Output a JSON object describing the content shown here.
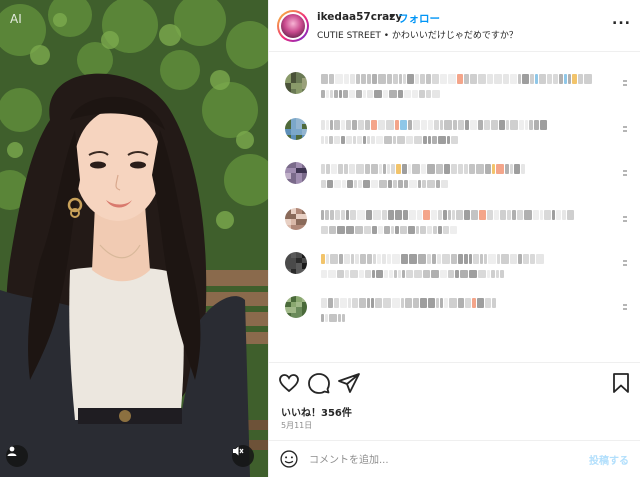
{
  "colors": {
    "accent": "#0095f6",
    "post_disabled": "#b2dffc",
    "text_primary": "#262626",
    "text_secondary": "#8e8e8e",
    "divider": "#efefef"
  },
  "media": {
    "ai_label": "AI",
    "icons": [
      "user-tag-icon",
      "mute-icon"
    ]
  },
  "header": {
    "username": "ikedaa57crazy",
    "separator": "•",
    "follow_label": "フォロー",
    "subtitle": "CUTIE STREET • かわいいだけじゃだめですか？",
    "more_icon": "more-options-icon",
    "more_label": "..."
  },
  "comments": [
    {
      "status": "pixelated"
    },
    {
      "status": "pixelated"
    },
    {
      "status": "pixelated"
    },
    {
      "status": "pixelated"
    },
    {
      "status": "pixelated"
    },
    {
      "status": "pixelated"
    }
  ],
  "actions": {
    "icons": [
      "heart-icon",
      "comment-icon",
      "share-icon",
      "bookmark-icon"
    ]
  },
  "likes_text": "いいね！356件",
  "date_text": "5月11日",
  "composer": {
    "emoji_icon": "emoji-icon",
    "placeholder": "コメントを追加...",
    "post_label": "投稿する"
  }
}
